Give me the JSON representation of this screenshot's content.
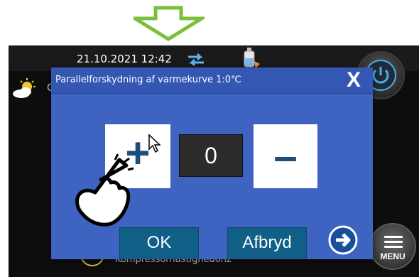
{
  "status_bar": {
    "datetime": "21.10.2021 12:42"
  },
  "dialog": {
    "title": "Parallelforskydning af varmekurve 1:0℃",
    "close_label": "X",
    "plus_label": "+",
    "value": "0",
    "minus_label": "–",
    "ok_label": "OK",
    "cancel_label": "Afbryd"
  },
  "background": {
    "partial_text": "C",
    "bottom_label": "Kompressorhastighedohz"
  },
  "menu": {
    "label": "MENU"
  },
  "icons": {
    "arrow": "down-arrow-outline-icon",
    "sync": "sync-arrows-icon",
    "tank": "water-tank-icon",
    "power": "power-icon",
    "weather": "partly-cloudy-icon",
    "next": "arrow-right-circle-icon",
    "cursor": "mouse-pointer-icon",
    "hand": "tap-hand-icon",
    "menu": "hamburger-menu-icon"
  },
  "colors": {
    "arrow_green": "#7bbf3a",
    "dialog_bg": "#3f63c0",
    "button_teal": "#0f5f86",
    "power_ring": "#4ab0e8"
  }
}
